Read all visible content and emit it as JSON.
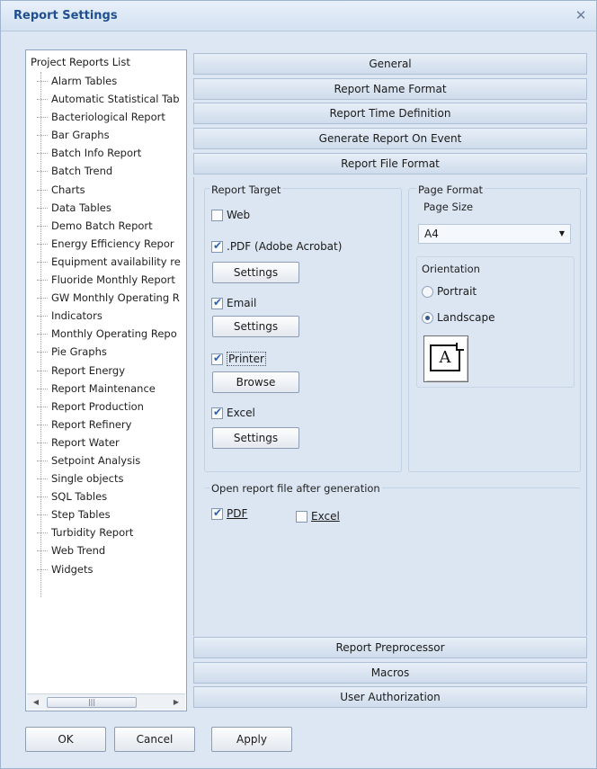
{
  "window": {
    "title": "Report Settings"
  },
  "tree": {
    "root": "Project Reports List",
    "items": [
      "Alarm Tables",
      "Automatic Statistical Tab",
      "Bacteriological Report",
      "Bar Graphs",
      "Batch Info Report",
      "Batch Trend",
      "Charts",
      "Data Tables",
      "Demo Batch Report",
      "Energy Efficiency Repor",
      "Equipment availability re",
      "Fluoride Monthly Report",
      "GW Monthly Operating R",
      "Indicators",
      "Monthly Operating Repo",
      "Pie Graphs",
      "Report Energy",
      "Report Maintenance",
      "Report Production",
      "Report Refinery",
      "Report Water",
      "Setpoint Analysis",
      "Single objects",
      "SQL Tables",
      "Step Tables",
      "Turbidity Report",
      "Web Trend",
      "Widgets"
    ]
  },
  "accordion": {
    "top": [
      "General",
      "Report Name Format",
      "Report Time Definition",
      "Generate Report On Event",
      "Report File Format"
    ],
    "bottom": [
      "Report Preprocessor",
      "Macros",
      "User Authorization"
    ]
  },
  "report_target": {
    "label": "Report Target",
    "web": {
      "label": "Web",
      "checked": false
    },
    "pdf": {
      "label": ".PDF (Adobe Acrobat)",
      "checked": true,
      "button": "Settings"
    },
    "email": {
      "label": "Email",
      "checked": true,
      "button": "Settings"
    },
    "printer": {
      "label": "Printer",
      "checked": true,
      "button": "Browse"
    },
    "excel": {
      "label": "Excel",
      "checked": true,
      "button": "Settings"
    }
  },
  "page_format": {
    "label": "Page Format",
    "page_size_label": "Page Size",
    "page_size_value": "A4",
    "orientation_label": "Orientation",
    "portrait": {
      "label": "Portrait",
      "selected": false
    },
    "landscape": {
      "label": "Landscape",
      "selected": true
    },
    "orientation_icon_letter": "A"
  },
  "open_after": {
    "label": "Open report file after generation",
    "pdf": {
      "label": "PDF",
      "checked": true
    },
    "excel": {
      "label": "Excel",
      "checked": false
    }
  },
  "footer": {
    "ok": "OK",
    "cancel": "Cancel",
    "apply": "Apply"
  }
}
